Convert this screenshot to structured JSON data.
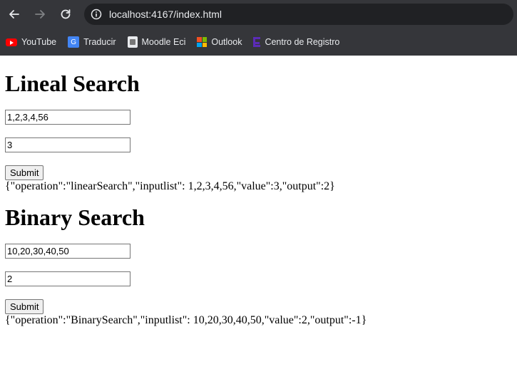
{
  "browser": {
    "url": "localhost:4167/index.html",
    "bookmarks": [
      {
        "label": "YouTube"
      },
      {
        "label": "Traducir"
      },
      {
        "label": "Moodle Eci"
      },
      {
        "label": "Outlook"
      },
      {
        "label": "Centro de Registro"
      }
    ],
    "translate_glyph": "G"
  },
  "linear": {
    "title": "Lineal Search",
    "list_value": "1,2,3,4,56",
    "search_value": "3",
    "submit_label": "Submit",
    "result": "{\"operation\":\"linearSearch\",\"inputlist\": 1,2,3,4,56,\"value\":3,\"output\":2}"
  },
  "binary": {
    "title": "Binary Search",
    "list_value": "10,20,30,40,50",
    "search_value": "2",
    "submit_label": "Submit",
    "result": "{\"operation\":\"BinarySearch\",\"inputlist\": 10,20,30,40,50,\"value\":2,\"output\":-1}"
  }
}
